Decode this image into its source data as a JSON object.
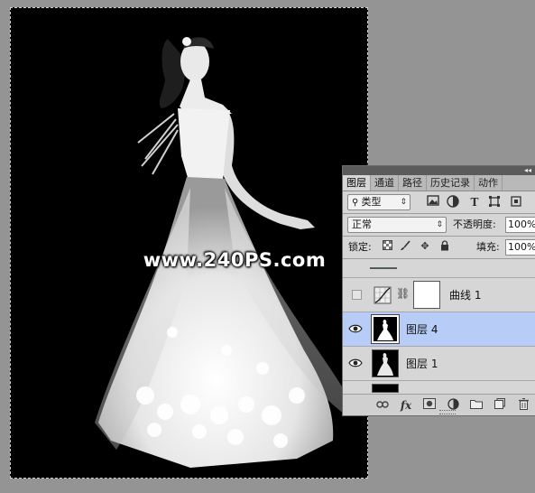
{
  "watermark": "www.240PS.com",
  "layers_panel": {
    "tabs": [
      "图层",
      "通道",
      "路径",
      "历史记录",
      "动作"
    ],
    "collapse_icon": "double-arrow",
    "filter_kind": "类型",
    "filter_icons": [
      "image-filter-icon",
      "adjustment-filter-icon",
      "text-filter-icon",
      "shape-filter-icon",
      "smart-object-filter-icon"
    ],
    "blend_mode": "正常",
    "opacity_label": "不透明度:",
    "opacity_value": "100%",
    "lock_label": "锁定:",
    "fill_label": "填充:",
    "fill_value": "100%",
    "layers": [
      {
        "name": "曲线 1",
        "visible": false,
        "selected": false,
        "type": "adjustment"
      },
      {
        "name": "图层 4",
        "visible": true,
        "selected": true,
        "type": "pixel"
      },
      {
        "name": "图层 1",
        "visible": true,
        "selected": false,
        "type": "pixel"
      }
    ],
    "footer_icons": [
      "link-icon",
      "fx-icon",
      "mask-icon",
      "adjustment-icon",
      "folder-icon",
      "new-layer-icon",
      "trash-icon"
    ],
    "footer_fx_text": "fx",
    "colors": {
      "selected_row": "#b7cdf7",
      "panel_bg": "#d6d6d6"
    }
  }
}
